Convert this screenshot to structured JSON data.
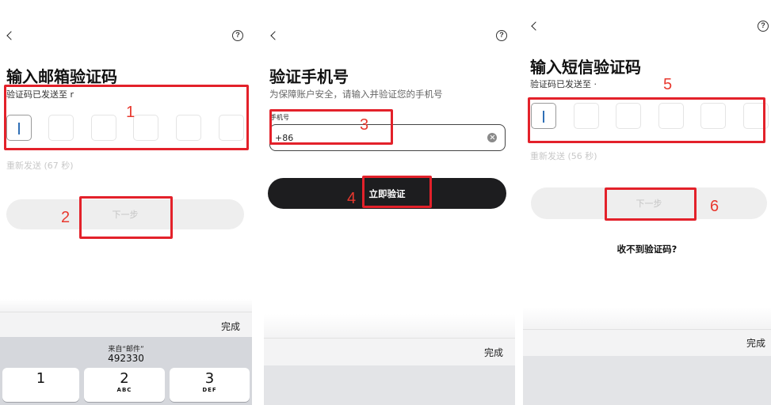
{
  "colors": {
    "annotation_red": "#e3212a",
    "annotation_number": "#e8382e",
    "primary_button": "#1d1d1f",
    "disabled_button": "#eeeeee",
    "disabled_text": "#c4c4c4",
    "cursor": "#2f6fb6",
    "keyboard_bg": "#d5d7dc"
  },
  "icons": {
    "back": "chevron-left-icon",
    "help": "help-circle-icon",
    "clear": "clear-circle-icon"
  },
  "panel_email": {
    "title": "输入邮箱验证码",
    "sent_to": "验证码已发送至 r",
    "resend": "重新发送 (67 秒)",
    "next_button": "下一步",
    "annotation_code": "1",
    "annotation_next": "2",
    "keyboard": {
      "done": "完成",
      "suggestion_source": "来自“邮件”",
      "suggestion_code": "492330",
      "keys": [
        {
          "digit": "1"
        },
        {
          "digit": "2",
          "letters": "ABC"
        },
        {
          "digit": "3",
          "letters": "DEF"
        }
      ]
    }
  },
  "panel_phone": {
    "title": "验证手机号",
    "subtitle": "为保障账户安全，请输入并验证您的手机号",
    "phone_label": "手机号",
    "country_code": "+86",
    "verify_button": "立即验证",
    "annotation_phone": "3",
    "annotation_verify": "4",
    "keyboard": {
      "done": "完成"
    }
  },
  "panel_sms": {
    "title": "输入短信验证码",
    "sent_to": "验证码已发送至 ·",
    "resend": "重新发送 (56 秒)",
    "next_button": "下一步",
    "cant_receive": "收不到验证码?",
    "annotation_code": "5",
    "annotation_next": "6",
    "keyboard": {
      "done": "完成"
    }
  }
}
